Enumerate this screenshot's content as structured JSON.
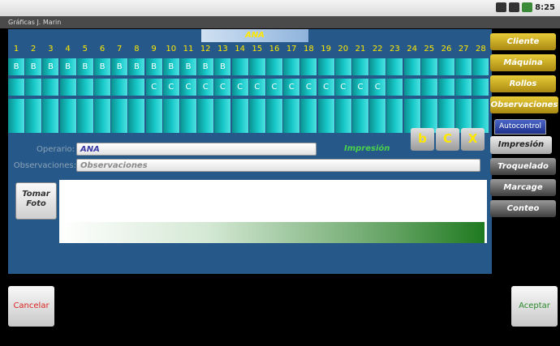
{
  "status_bar": {
    "time": "8:25"
  },
  "window": {
    "title": "Gráficas J. Marin"
  },
  "operator_banner": "ANA",
  "days": [
    "1",
    "2",
    "3",
    "4",
    "5",
    "6",
    "7",
    "8",
    "9",
    "10",
    "11",
    "12",
    "13",
    "14",
    "15",
    "16",
    "17",
    "18",
    "19",
    "20",
    "21",
    "22",
    "23",
    "24",
    "25",
    "26",
    "27",
    "28"
  ],
  "grid": {
    "rows": [
      [
        "B",
        "B",
        "B",
        "B",
        "B",
        "B",
        "B",
        "B",
        "B",
        "B",
        "B",
        "B",
        "B",
        "",
        "",
        "",
        "",
        "",
        "",
        "",
        "",
        "",
        "",
        "",
        "",
        "",
        "",
        ""
      ],
      [
        "",
        "",
        "",
        "",
        "",
        "",
        "",
        "",
        "C",
        "C",
        "C",
        "C",
        "C",
        "C",
        "C",
        "C",
        "C",
        "C",
        "C",
        "C",
        "C",
        "C",
        "",
        "",
        "",
        "",
        "",
        ""
      ],
      [
        "",
        "",
        "",
        "",
        "",
        "",
        "",
        "",
        "",
        "",
        "",
        "",
        "",
        "",
        "",
        "",
        "",
        "",
        "",
        "",
        "",
        "",
        "",
        "",
        "",
        "",
        "",
        ""
      ],
      [
        "",
        "",
        "",
        "",
        "",
        "",
        "",
        "",
        "",
        "",
        "",
        "",
        "",
        "",
        "",
        "",
        "",
        "",
        "",
        "",
        "",
        "",
        "",
        "",
        "",
        "",
        "",
        ""
      ]
    ]
  },
  "form": {
    "operario_label": "Operario:",
    "operario_value": "ANA",
    "observaciones_label": "Observaciones:",
    "observaciones_placeholder": "Observaciones",
    "impresion_label": "Impresión"
  },
  "style_buttons": {
    "bold": "b",
    "color": "C",
    "clear": "X"
  },
  "tomar_foto": {
    "line1": "Tomar",
    "line2": "Foto"
  },
  "progress": {
    "value": 1.0
  },
  "sidebar": {
    "cliente": "Cliente",
    "maquina": "Máquina",
    "rollos": "Rollos",
    "observaciones": "Observaciones",
    "autocontrol": "Autocontrol",
    "impresion": "Impresión",
    "troquelado": "Troquelado",
    "marcage": "Marcage",
    "conteo": "Conteo"
  },
  "buttons": {
    "cancel": "Cancelar",
    "accept": "Aceptar"
  },
  "colors": {
    "accent_yellow": "#ffe800",
    "panel_blue": "#26598a",
    "cell_cyan": "#18c9c9",
    "progress_green": "#1f7a1f"
  }
}
